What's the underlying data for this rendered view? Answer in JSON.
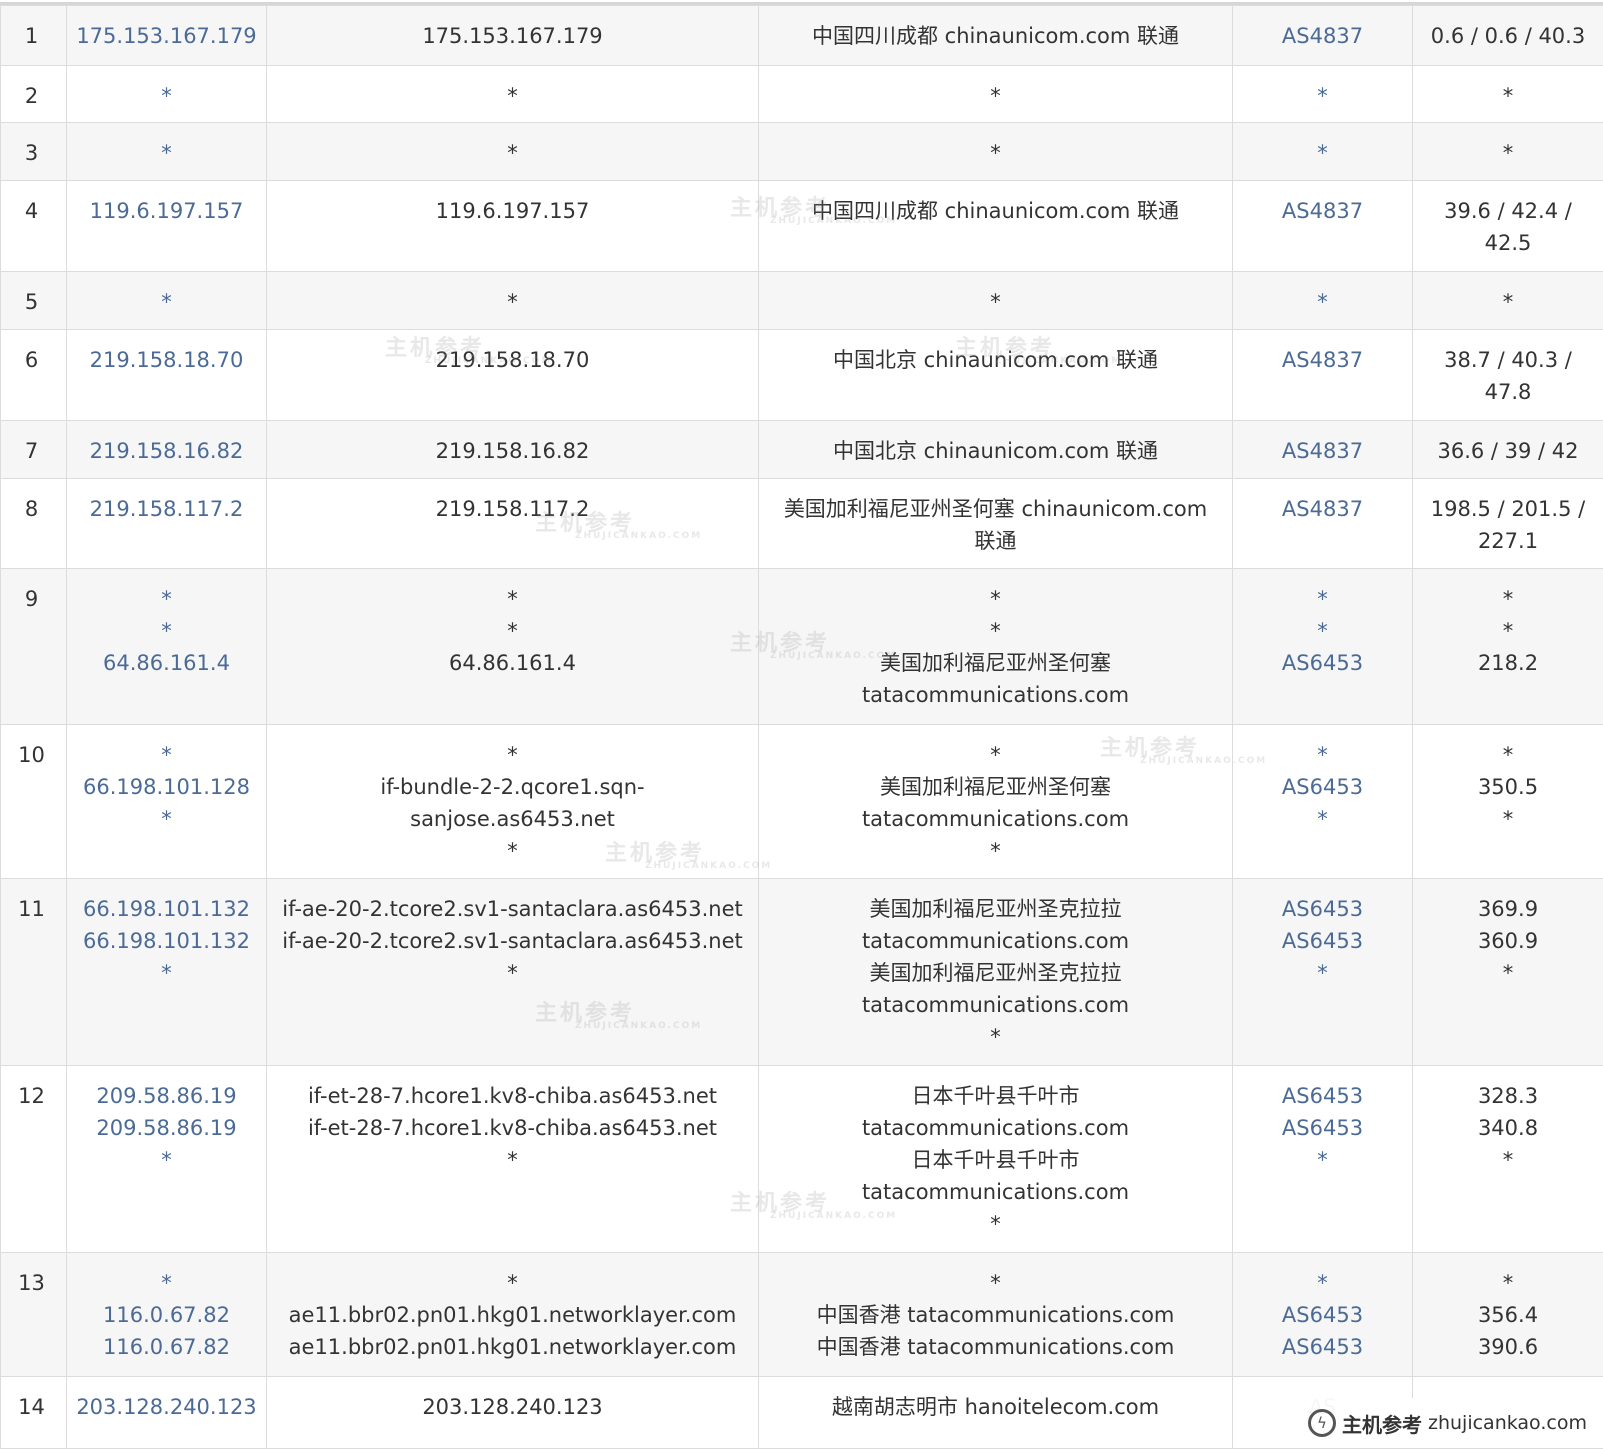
{
  "rows": [
    {
      "hop": "1",
      "ip": "175.153.167.179",
      "host": "175.153.167.179",
      "location": "中国四川成都 chinaunicom.com 联通",
      "as": "AS4837",
      "latency": "0.6 / 0.6 / 40.3"
    },
    {
      "hop": "2",
      "ip": "*",
      "host": "*",
      "location": "*",
      "as": "*",
      "latency": "*"
    },
    {
      "hop": "3",
      "ip": "*",
      "host": "*",
      "location": "*",
      "as": "*",
      "latency": "*"
    },
    {
      "hop": "4",
      "ip": "119.6.197.157",
      "host": "119.6.197.157",
      "location": "中国四川成都 chinaunicom.com 联通",
      "as": "AS4837",
      "latency": "39.6 / 42.4 /\n42.5"
    },
    {
      "hop": "5",
      "ip": "*",
      "host": "*",
      "location": "*",
      "as": "*",
      "latency": "*"
    },
    {
      "hop": "6",
      "ip": "219.158.18.70",
      "host": "219.158.18.70",
      "location": "中国北京 chinaunicom.com 联通",
      "as": "AS4837",
      "latency": "38.7 / 40.3 /\n47.8"
    },
    {
      "hop": "7",
      "ip": "219.158.16.82",
      "host": "219.158.16.82",
      "location": "中国北京 chinaunicom.com 联通",
      "as": "AS4837",
      "latency": "36.6 / 39 / 42"
    },
    {
      "hop": "8",
      "ip": "219.158.117.2",
      "host": "219.158.117.2",
      "location": "美国加利福尼亚州圣何塞 chinaunicom.com\n联通",
      "as": "AS4837",
      "latency": "198.5 / 201.5 /\n227.1"
    },
    {
      "hop": "9",
      "ip": "*\n*\n64.86.161.4",
      "host": "*\n*\n64.86.161.4",
      "location": "*\n*\n美国加利福尼亚州圣何塞\ntatacommunications.com",
      "as": "*\n*\nAS6453",
      "latency": "*\n*\n218.2"
    },
    {
      "hop": "10",
      "ip": "*\n66.198.101.128\n*",
      "host": "*\nif-bundle-2-2.qcore1.sqn-\nsanjose.as6453.net\n*",
      "location": "*\n美国加利福尼亚州圣何塞\ntatacommunications.com\n*",
      "as": "*\nAS6453\n*",
      "latency": "*\n350.5\n*"
    },
    {
      "hop": "11",
      "ip": "66.198.101.132\n66.198.101.132\n*",
      "host": "if-ae-20-2.tcore2.sv1-santaclara.as6453.net\nif-ae-20-2.tcore2.sv1-santaclara.as6453.net\n*",
      "location": "美国加利福尼亚州圣克拉拉\ntatacommunications.com\n美国加利福尼亚州圣克拉拉\ntatacommunications.com\n*",
      "as": "AS6453\nAS6453\n*",
      "latency": "369.9\n360.9\n*"
    },
    {
      "hop": "12",
      "ip": "209.58.86.19\n209.58.86.19\n*",
      "host": "if-et-28-7.hcore1.kv8-chiba.as6453.net\nif-et-28-7.hcore1.kv8-chiba.as6453.net\n*",
      "location": "日本千叶县千叶市\ntatacommunications.com\n日本千叶县千叶市\ntatacommunications.com\n*",
      "as": "AS6453\nAS6453\n*",
      "latency": "328.3\n340.8\n*"
    },
    {
      "hop": "13",
      "ip": "*\n116.0.67.82\n116.0.67.82",
      "host": "*\nae11.bbr02.pn01.hkg01.networklayer.com\nae11.bbr02.pn01.hkg01.networklayer.com",
      "location": "*\n中国香港 tatacommunications.com\n中国香港 tatacommunications.com",
      "as": "*\nAS6453\nAS6453",
      "latency": "*\n356.4\n390.6"
    },
    {
      "hop": "14",
      "ip": "203.128.240.123",
      "host": "203.128.240.123",
      "location": "越南胡志明市 hanoitelecom.com",
      "as": "AS",
      "latency": ""
    }
  ],
  "watermark": {
    "cn": "主机参考",
    "en": "ZHUJICANKAO.COM",
    "badge_cn": "主机参考",
    "badge_en": "zhujicankao.com"
  },
  "colors": {
    "link": "#4b6a96",
    "text": "#333333",
    "stripe": "#f6f6f6",
    "border": "#dcdcdc"
  }
}
